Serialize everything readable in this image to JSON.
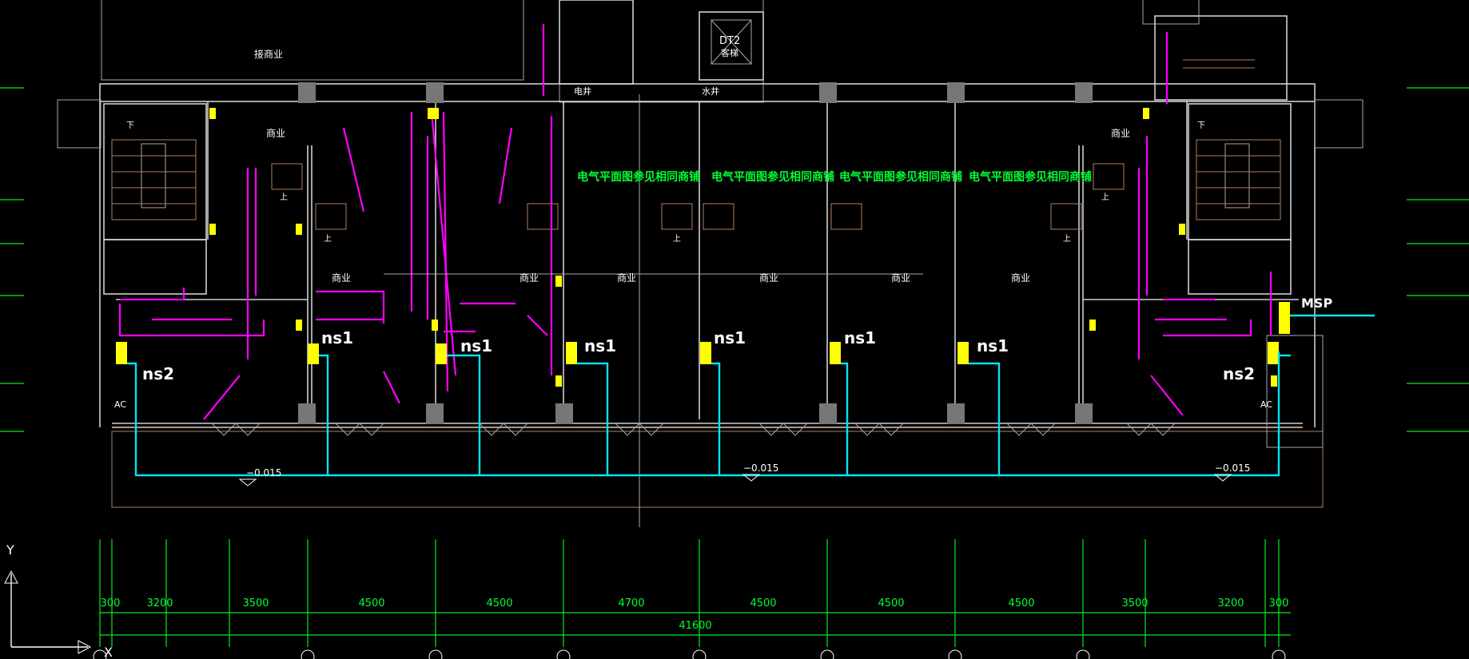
{
  "labels": {
    "commerce": "商业",
    "connect_commerce": "接商业",
    "elec_well": "电井",
    "water_well": "水井",
    "elevator_id": "DT2",
    "elevator_room": "客梯",
    "note": "电气平面图参见相同商铺",
    "stair_up": "上",
    "stair_down": "下",
    "panel_ns1": "ns1",
    "panel_ns2": "ns2",
    "panel_msp": "MSP",
    "elevation": "−0.015",
    "ac": "AC"
  },
  "dimensions": {
    "bays": [
      "300",
      "3200",
      "3500",
      "4500",
      "4500",
      "4700",
      "4500",
      "4500",
      "4500",
      "3500",
      "3200",
      "300"
    ],
    "total": "41600"
  },
  "ucs": {
    "y_axis": "Y",
    "x_axis": "X"
  },
  "colors": {
    "background": "#000000",
    "walls": "#cfcfcf",
    "lighting_circuit": "#ff00ff",
    "power_trunk": "#00e5ee",
    "dimension": "#00ee22",
    "panel": "#ffff00",
    "annotation": "#00ff33"
  }
}
